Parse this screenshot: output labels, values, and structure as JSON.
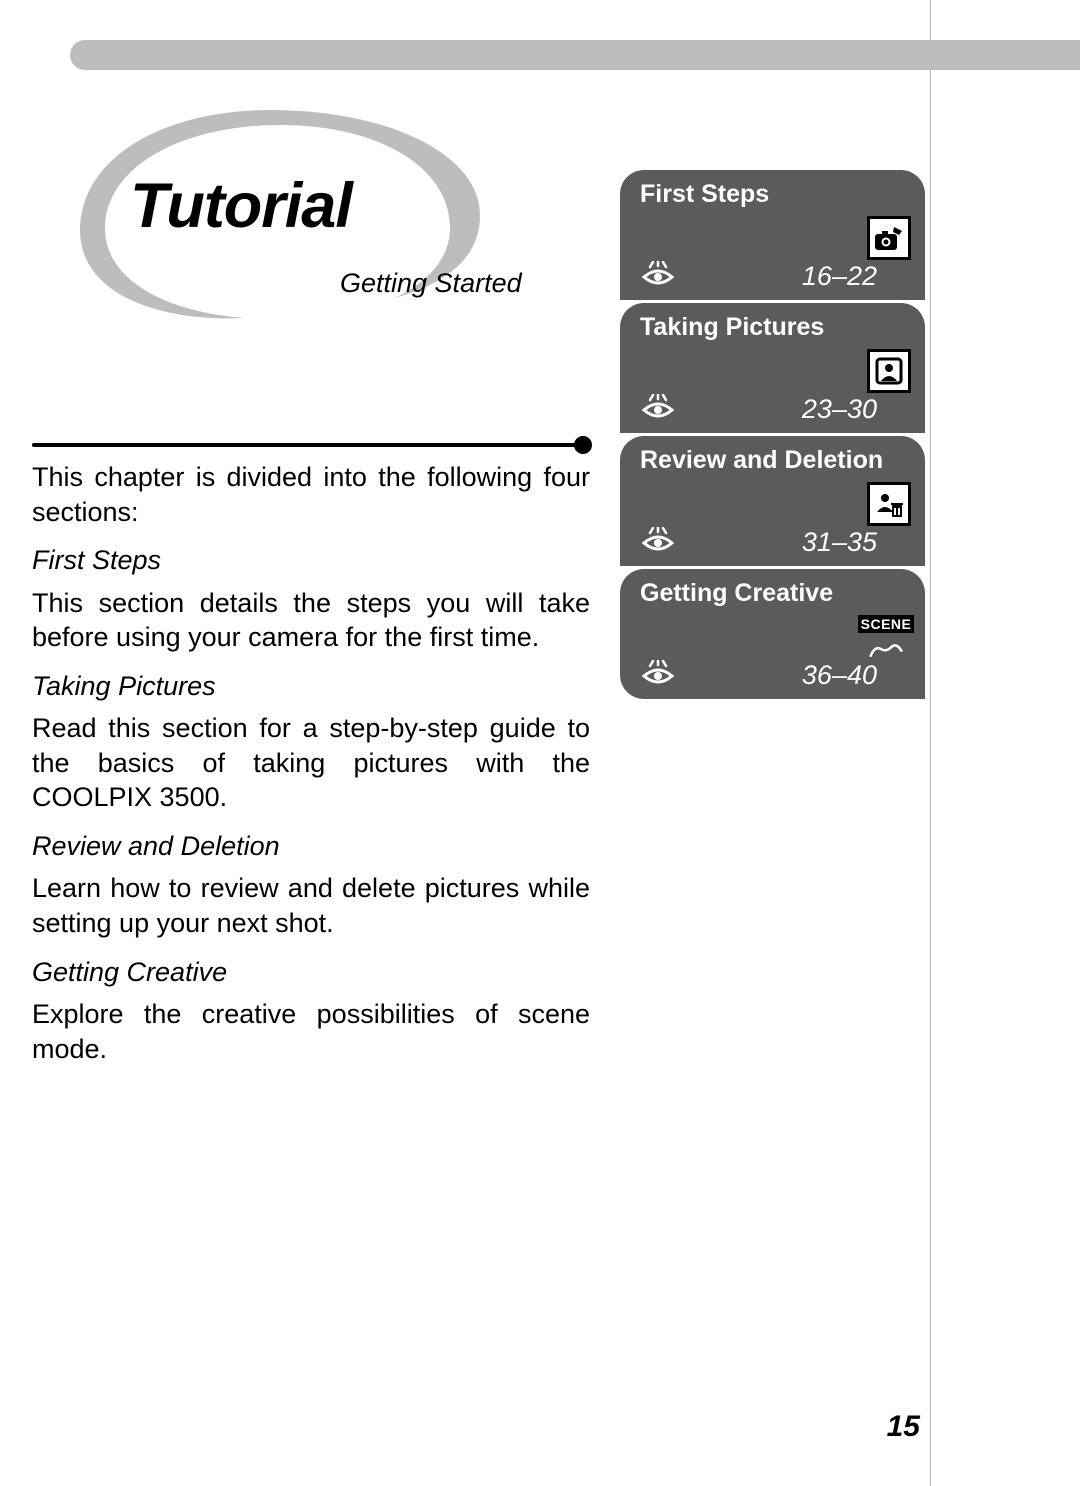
{
  "header": {
    "title": "Tutorial",
    "subtitle": "Getting Started"
  },
  "sidebar": {
    "cards": [
      {
        "title": "First Steps",
        "pages": "16–22",
        "icon": "camera-hand"
      },
      {
        "title": "Taking Pictures",
        "pages": "23–30",
        "icon": "portrait"
      },
      {
        "title": "Review and Deletion",
        "pages": "31–35",
        "icon": "review-delete"
      },
      {
        "title": "Getting Creative",
        "pages": "36–40",
        "icon": "scene",
        "icon_label": "SCENE"
      }
    ]
  },
  "body": {
    "intro": "This chapter is divided into the following four sections:",
    "sections": [
      {
        "heading": "First Steps",
        "text": "This section details the steps you will take before using your camera for the first time."
      },
      {
        "heading": "Taking Pictures",
        "text": "Read this section for a step-by-step guide to the basics of taking pictures with the COOLPIX 3500."
      },
      {
        "heading": "Review and Deletion",
        "text": "Learn how to review and delete pictures while setting up your next shot."
      },
      {
        "heading": "Getting Creative",
        "text": "Explore the creative possibilities of scene mode."
      }
    ]
  },
  "page_number": "15"
}
